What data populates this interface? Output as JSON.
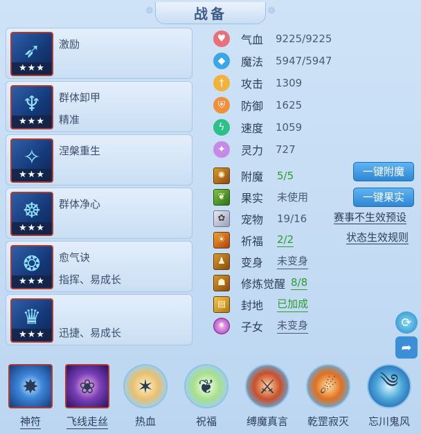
{
  "title": "战备",
  "skills": [
    {
      "name": "激励",
      "desc": "",
      "stars": "★★★",
      "icon": "bow-icon"
    },
    {
      "name": "群体卸甲",
      "desc": "精准",
      "stars": "★★★",
      "icon": "armor-break-icon"
    },
    {
      "name": "涅槃重生",
      "desc": "",
      "stars": "★★★",
      "icon": "rebirth-icon"
    },
    {
      "name": "群体净心",
      "desc": "",
      "stars": "★★★",
      "icon": "purify-icon"
    },
    {
      "name": "愈气诀",
      "desc": "指挥、易成长",
      "stars": "★★★",
      "icon": "heal-icon"
    },
    {
      "name": "",
      "desc": "迅捷、易成长",
      "stars": "★★★",
      "icon": "crown-icon"
    }
  ],
  "stats": [
    {
      "label": "气血",
      "value": "9225/9225",
      "color": "#e8707a",
      "icon": "heart-icon"
    },
    {
      "label": "魔法",
      "value": "5947/5947",
      "color": "#3aa6e8",
      "icon": "mana-icon"
    },
    {
      "label": "攻击",
      "value": "1309",
      "color": "#f0b23a",
      "icon": "sword-icon"
    },
    {
      "label": "防御",
      "value": "1625",
      "color": "#f0903a",
      "icon": "shield-icon"
    },
    {
      "label": "速度",
      "value": "1059",
      "color": "#2cc08a",
      "icon": "lightning-icon"
    },
    {
      "label": "灵力",
      "value": "727",
      "color": "#c58ae8",
      "icon": "spirit-icon"
    }
  ],
  "props": {
    "enchant": {
      "label": "附魔",
      "value": "5/5"
    },
    "fruit": {
      "label": "果实",
      "value": "未使用"
    },
    "pet": {
      "label": "宠物",
      "value": "19/16"
    },
    "bless": {
      "label": "祈福",
      "value": "2/2"
    },
    "transform": {
      "label": "变身",
      "value": "未变身"
    },
    "awaken": {
      "label": "修炼觉醒",
      "value": "8/8"
    },
    "land": {
      "label": "封地",
      "value": "已加成"
    },
    "children": {
      "label": "子女",
      "value": "未变身"
    }
  },
  "buttons": {
    "enchant": "一键附魔",
    "fruit": "一键果实"
  },
  "links": {
    "preset": "赛事不生效预设",
    "rules": "状态生效规则"
  },
  "bottom": [
    {
      "label": "神符",
      "underline": true
    },
    {
      "label": "飞线走丝",
      "underline": true
    },
    {
      "label": "热血",
      "underline": false
    },
    {
      "label": "祝福",
      "underline": false
    },
    {
      "label": "缚魔真言",
      "underline": false
    },
    {
      "label": "乾罡寂灭",
      "underline": false
    },
    {
      "label": "忘川鬼风",
      "underline": false
    }
  ]
}
